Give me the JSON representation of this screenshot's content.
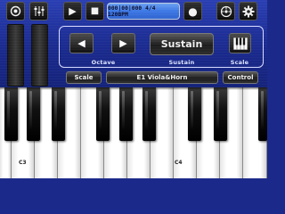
{
  "transport": {
    "lcd_text": "000|00|000 4/4 120BPM",
    "play_glyph": "▶",
    "stop_glyph": "■",
    "record_glyph": "●",
    "icons": [
      "loop-icon",
      "mixer-icon",
      "play-icon",
      "stop-icon",
      "record-icon",
      "metronome-icon",
      "settings-gear-icon"
    ]
  },
  "controls": {
    "octave_down_glyph": "◀",
    "octave_up_glyph": "▶",
    "octave_label": "Octave",
    "sustain_button": "Sustain",
    "sustain_label": "Sustain",
    "scale_label": "Scale",
    "panel_scale_button": "Scale",
    "instrument_name": "E1 Viola&Horn",
    "control_button": "Control"
  },
  "keyboard": {
    "labels": [
      "C3",
      "C4"
    ]
  },
  "colors": {
    "panel_blue": "#1a2a8e",
    "lcd_blue": "#3d78e4",
    "button_dark": "#111111"
  }
}
